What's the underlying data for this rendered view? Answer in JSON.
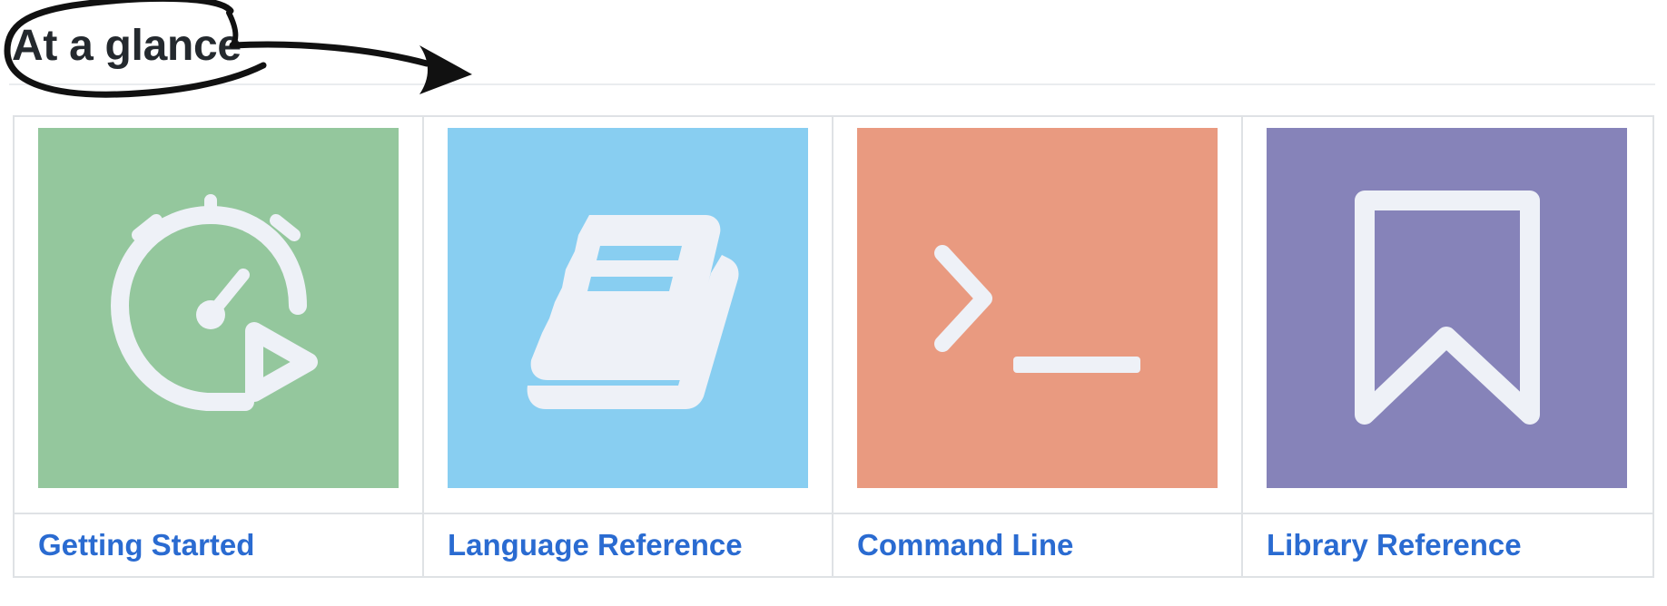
{
  "section": {
    "title": "At a glance"
  },
  "cards": [
    {
      "label": "Getting Started",
      "icon": "stopwatch-play-icon",
      "color": "#94c79d"
    },
    {
      "label": "Language Reference",
      "icon": "book-icon",
      "color": "#88cef1"
    },
    {
      "label": "Command Line",
      "icon": "terminal-prompt-icon",
      "color": "#e99a80"
    },
    {
      "label": "Library Reference",
      "icon": "bookmark-icon",
      "color": "#8683b9"
    }
  ],
  "colors": {
    "heading": "#24292e",
    "link": "#2a6bd1",
    "border": "#dfe2e5",
    "icon_fill": "#eef1f7"
  }
}
